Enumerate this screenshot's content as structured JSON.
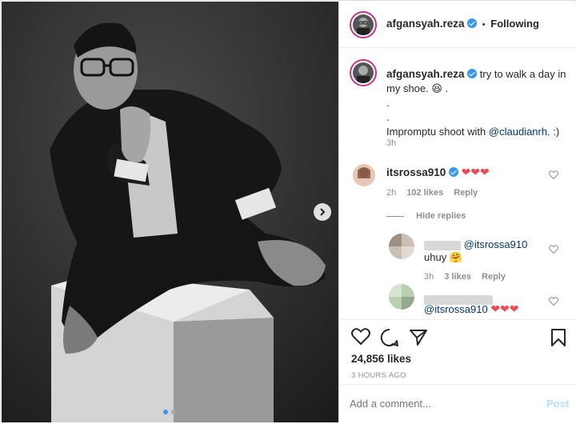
{
  "colors": {
    "accent": "#3897f0",
    "heart": "#ed4956",
    "link": "#00376b",
    "muted": "#8e8e8e"
  },
  "header": {
    "username": "afgansyah.reza",
    "follow_status": "Following",
    "separator": "•"
  },
  "caption": {
    "username": "afgansyah.reza",
    "line1": "try to walk a day in my shoe.",
    "emoji": "😆",
    "dot1": ".",
    "dot2": ".",
    "dot3": ".",
    "line2_prefix": "Impromptu shoot with",
    "mention": "@claudianrh",
    "line2_suffix": ". :)",
    "time": "3h"
  },
  "comments": [
    {
      "username": "itsrossa910",
      "hearts": "❤❤❤",
      "time": "2h",
      "likes": "102 likes",
      "reply_label": "Reply",
      "hide_replies": "Hide replies"
    }
  ],
  "replies": [
    {
      "mention": "@itsrossa910",
      "text": "uhuy",
      "emoji": "🤗",
      "time": "3h",
      "likes": "3 likes",
      "reply_label": "Reply"
    },
    {
      "mention": "@itsrossa910",
      "hearts": "❤❤❤"
    }
  ],
  "post": {
    "likes": "24,856 likes",
    "timestamp": "3 HOURS AGO",
    "icons": [
      "heart-icon",
      "comment-icon",
      "share-icon",
      "bookmark-icon"
    ]
  },
  "composer": {
    "placeholder": "Add a comment...",
    "post_label": "Post"
  },
  "carousel": {
    "current": 1,
    "total": 2
  }
}
